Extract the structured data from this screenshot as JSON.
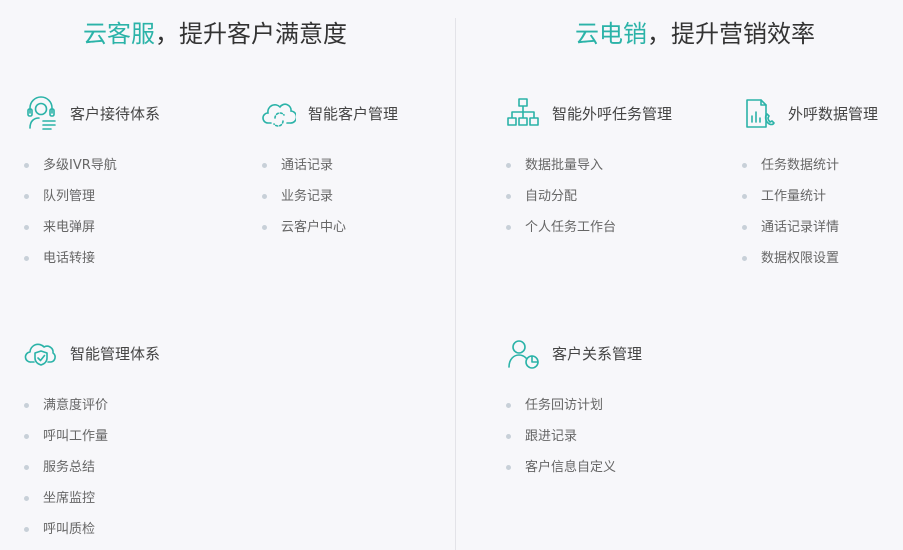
{
  "left": {
    "headline_accent": "云客服",
    "headline_rest": "，提升客户满意度",
    "blocks": [
      {
        "title": "客户接待体系",
        "icon": "customer-service-headset-icon",
        "items": [
          "多级IVR导航",
          "队列管理",
          "来电弹屏",
          "电话转接"
        ]
      },
      {
        "title": "智能客户管理",
        "icon": "cloud-sync-icon",
        "items": [
          "通话记录",
          "业务记录",
          "云客户中心"
        ]
      },
      {
        "title": "智能管理体系",
        "icon": "cloud-shield-icon",
        "items": [
          "满意度评价",
          "呼叫工作量",
          "服务总结",
          "坐席监控",
          "呼叫质检"
        ]
      }
    ]
  },
  "right": {
    "headline_accent": "云电销",
    "headline_rest": "，提升营销效率",
    "blocks": [
      {
        "title": "智能外呼任务管理",
        "icon": "org-chart-icon",
        "items": [
          "数据批量导入",
          "自动分配",
          "个人任务工作台"
        ]
      },
      {
        "title": "外呼数据管理",
        "icon": "data-report-phone-icon",
        "items": [
          "任务数据统计",
          "工作量统计",
          "通话记录详情",
          "数据权限设置"
        ]
      },
      {
        "title": "客户关系管理",
        "icon": "user-pie-chart-icon",
        "items": [
          "任务回访计划",
          "跟进记录",
          "客户信息自定义"
        ]
      }
    ]
  },
  "colors": {
    "accent": "#2bb3a8",
    "text": "#444444",
    "bullet": "#c8d0d8",
    "background": "#f7f7fa"
  }
}
